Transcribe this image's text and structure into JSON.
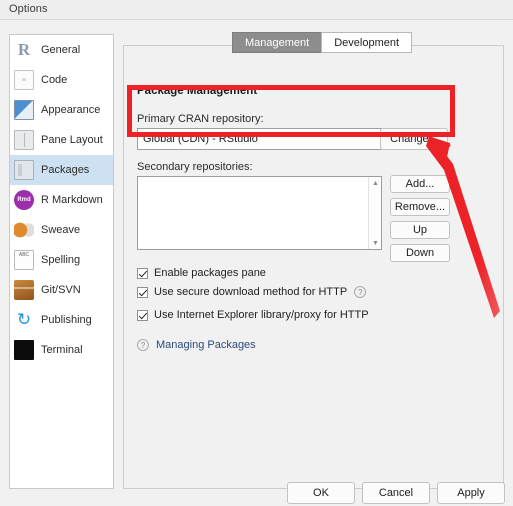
{
  "window": {
    "title": "Options"
  },
  "sidebar": {
    "items": [
      {
        "label": "General",
        "icon": "r-logo-icon",
        "selected": false,
        "glyph": "R"
      },
      {
        "label": "Code",
        "icon": "code-lines-icon",
        "selected": false,
        "glyph": "≡"
      },
      {
        "label": "Appearance",
        "icon": "appearance-icon",
        "selected": false,
        "glyph": ""
      },
      {
        "label": "Pane Layout",
        "icon": "pane-layout-icon",
        "selected": false,
        "glyph": ""
      },
      {
        "label": "Packages",
        "icon": "packages-box-icon",
        "selected": true,
        "glyph": ""
      },
      {
        "label": "R Markdown",
        "icon": "r-markdown-icon",
        "selected": false,
        "glyph": "Rmd"
      },
      {
        "label": "Sweave",
        "icon": "sweave-icon",
        "selected": false,
        "glyph": ""
      },
      {
        "label": "Spelling",
        "icon": "spelling-abc-icon",
        "selected": false,
        "glyph": "ABC"
      },
      {
        "label": "Git/SVN",
        "icon": "git-svn-box-icon",
        "selected": false,
        "glyph": ""
      },
      {
        "label": "Publishing",
        "icon": "publishing-icon",
        "selected": false,
        "glyph": "↻"
      },
      {
        "label": "Terminal",
        "icon": "terminal-icon",
        "selected": false,
        "glyph": ""
      }
    ]
  },
  "main": {
    "tabs": [
      {
        "label": "Management",
        "active": true
      },
      {
        "label": "Development",
        "active": false
      }
    ],
    "section_title": "Package Management",
    "primary_repo": {
      "label": "Primary CRAN repository:",
      "value": "Global (CDN) - RStudio",
      "change_button": "Change..."
    },
    "secondary_repos": {
      "label": "Secondary repositories:",
      "items": [],
      "buttons": [
        "Add...",
        "Remove...",
        "Up",
        "Down"
      ],
      "scroll_up_glyph": "▲",
      "scroll_down_glyph": "▼"
    },
    "checkboxes": [
      {
        "label": "Enable packages pane",
        "checked": true,
        "has_help": false
      },
      {
        "label": "Use secure download method for HTTP",
        "checked": true,
        "has_help": true
      },
      {
        "label": "Use Internet Explorer library/proxy for HTTP",
        "checked": true,
        "has_help": false
      }
    ],
    "help_link": {
      "text": "Managing Packages",
      "icon_glyph": "?"
    }
  },
  "footer": {
    "ok": "OK",
    "cancel": "Cancel",
    "apply": "Apply"
  },
  "annotations": {
    "highlight_color": "#ec2227",
    "rect_target": "primary-cran-repository-field",
    "arrow_direction": "up-left"
  }
}
